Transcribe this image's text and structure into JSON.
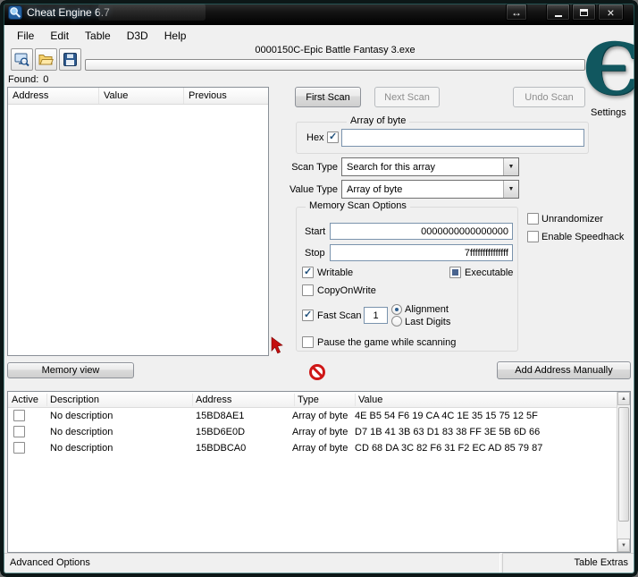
{
  "window": {
    "title": "Cheat Engine 6.7",
    "icons": {
      "attach": "↔",
      "close": "×"
    }
  },
  "glyphs": {
    "up": "▲",
    "down": "▼",
    "dropdown": "▼"
  },
  "menu": {
    "items": [
      "File",
      "Edit",
      "Table",
      "D3D",
      "Help"
    ]
  },
  "process": {
    "name": "0000150C-Epic Battle Fantasy 3.exe",
    "progress_percent": 0
  },
  "found": {
    "label": "Found:",
    "count": "0",
    "columns": [
      "Address",
      "Value",
      "Previous"
    ]
  },
  "scan": {
    "buttons": {
      "first": "First Scan",
      "next": "Next Scan",
      "undo": "Undo Scan"
    },
    "group_label": "Array of byte",
    "hex": {
      "label": "Hex",
      "checked": true,
      "value": ""
    },
    "scan_type": {
      "label": "Scan Type",
      "value": "Search for this array"
    },
    "value_type": {
      "label": "Value Type",
      "value": "Array of byte"
    },
    "memory_options": {
      "title": "Memory Scan Options",
      "start": {
        "label": "Start",
        "value": "0000000000000000"
      },
      "stop": {
        "label": "Stop",
        "value": "7fffffffffffffff"
      },
      "writable": {
        "label": "Writable",
        "checked": true
      },
      "executable": {
        "label": "Executable",
        "state": "indeterminate"
      },
      "copy_on_write": {
        "label": "CopyOnWrite",
        "checked": false
      },
      "fast_scan": {
        "label": "Fast Scan",
        "checked": true,
        "value": "1"
      },
      "alignment": {
        "label": "Alignment",
        "selected": true
      },
      "last_digits": {
        "label": "Last Digits",
        "selected": false
      },
      "pause": {
        "label": "Pause the game while scanning",
        "checked": false
      }
    },
    "unrandomizer": {
      "label": "Unrandomizer",
      "checked": false
    },
    "speedhack": {
      "label": "Enable Speedhack",
      "checked": false
    }
  },
  "settings": {
    "label": "Settings"
  },
  "actions": {
    "memory_view": "Memory view",
    "add_address": "Add Address Manually"
  },
  "address_list": {
    "columns": [
      "Active",
      "Description",
      "Address",
      "Type",
      "Value"
    ],
    "rows": [
      {
        "active": false,
        "description": "No description",
        "address": "15BD8AE1",
        "type": "Array of byte",
        "value": "4E B5 54 F6 19 CA 4C 1E 35 15 75 12 5F"
      },
      {
        "active": false,
        "description": "No description",
        "address": "15BD6E0D",
        "type": "Array of byte",
        "value": "D7 1B 41 3B 63 D1 83 38 FF 3E 5B 6D 66"
      },
      {
        "active": false,
        "description": "No description",
        "address": "15BDBCA0",
        "type": "Array of byte",
        "value": "CD 68 DA 3C 82 F6 31 F2 EC AD 85 79 87"
      }
    ]
  },
  "statusbar": {
    "left": "Advanced Options",
    "right": "Table Extras"
  },
  "colors": {
    "accent_teal": "#11575f",
    "danger_red": "#cf1717",
    "title_bg": "#0b0b0b"
  }
}
